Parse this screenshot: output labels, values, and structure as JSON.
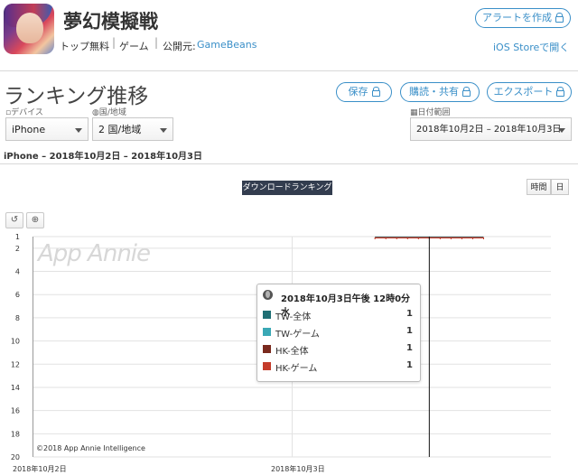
{
  "app": {
    "title": "夢幻模擬戦",
    "category_free": "トップ無料",
    "category_game": "ゲーム",
    "publisher_label": "公開元:",
    "publisher": "GameBeans"
  },
  "header_actions": {
    "alert": "アラートを作成",
    "ios_store": "iOS Storeで開く"
  },
  "section": {
    "title": "ランキング推移",
    "save": "保存",
    "subscribe": "購読・共有",
    "export": "エクスポート"
  },
  "filters": {
    "device_label": "デバイス",
    "device_value": "iPhone",
    "country_label": "国/地域",
    "country_value": "2 国/地域",
    "date_label": "日付範囲",
    "date_value": "2018年10月2日 – 2018年10月3日"
  },
  "subtitle": "iPhone – 2018年10月2日 – 2018年10月3日",
  "ranking_button": "ダウンロードランキング",
  "granularity": {
    "hourly": "時間",
    "daily": "日"
  },
  "chart_data": {
    "type": "line",
    "xlabel": "",
    "ylabel": "",
    "x_ticks": [
      "2018年10月2日",
      "2018年10月3日"
    ],
    "y_ticks": [
      "1",
      "2",
      "4",
      "6",
      "8",
      "10",
      "12",
      "14",
      "16",
      "18",
      "20"
    ],
    "y_inverted": true,
    "ylim": [
      1,
      20
    ],
    "watermark": "App Annie",
    "copyright": "©2018 App Annie Intelligence",
    "series": [
      {
        "name": "TW-全体",
        "color": "#1f6f74",
        "values": [
          1,
          1,
          1,
          1,
          1,
          1,
          1,
          1,
          1,
          1,
          1
        ]
      },
      {
        "name": "TW-ゲーム",
        "color": "#3aa8b5",
        "values": [
          1,
          1,
          1,
          1,
          1,
          1,
          1,
          1,
          1,
          1,
          1
        ]
      },
      {
        "name": "HK-全体",
        "color": "#7a2a1e",
        "values": [
          1,
          1,
          1,
          1,
          1,
          1,
          1,
          1,
          1,
          1,
          1
        ]
      },
      {
        "name": "HK-ゲーム",
        "color": "#c43b2a",
        "values": [
          1,
          1,
          1,
          1,
          1,
          1,
          1,
          1,
          1,
          1,
          1
        ]
      }
    ],
    "tooltip": {
      "title": "2018年10月3日午後 12時0分 水",
      "rows": [
        {
          "label": "TW-全体",
          "value": "1"
        },
        {
          "label": "TW-ゲーム",
          "value": "1"
        },
        {
          "label": "HK-全体",
          "value": "1"
        },
        {
          "label": "HK-ゲーム",
          "value": "1"
        }
      ]
    }
  }
}
